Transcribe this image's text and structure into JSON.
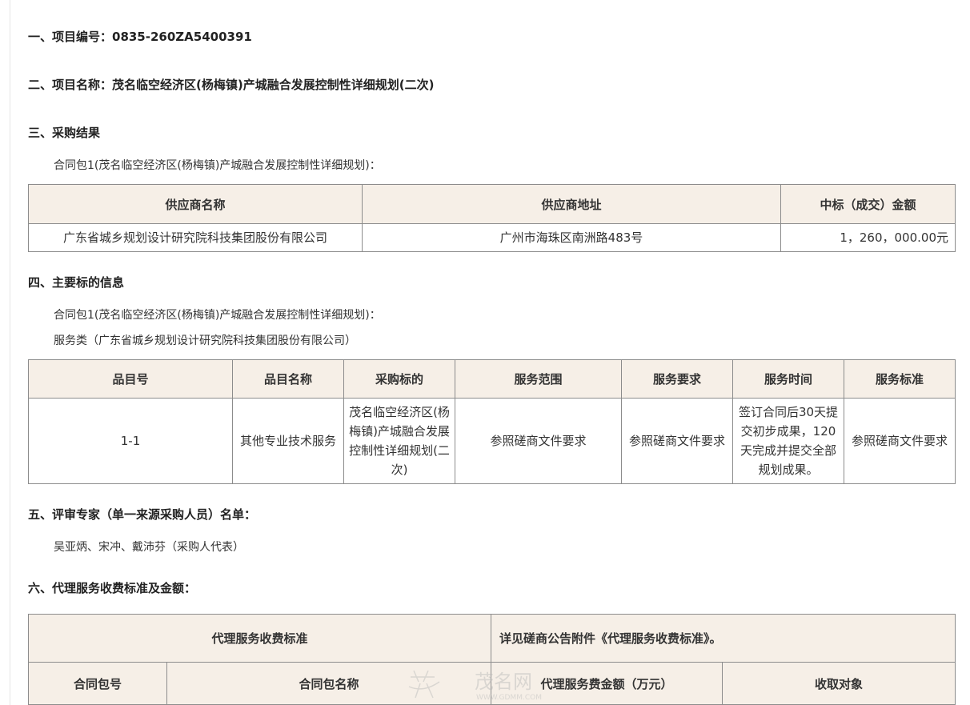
{
  "sections": {
    "s1": "一、项目编号：0835-260ZA5400391",
    "s2": "二、项目名称：茂名临空经济区(杨梅镇)产城融合发展控制性详细规划(二次)",
    "s3": "三、采购结果",
    "s4": "四、主要标的信息",
    "s5": "五、评审专家（单一来源采购人员）名单：",
    "s6": "六、代理服务收费标准及金额："
  },
  "result": {
    "package_label": "合同包1(茂名临空经济区(杨梅镇)产城融合发展控制性详细规划)：",
    "headers": [
      "供应商名称",
      "供应商地址",
      "中标（成交）金额"
    ],
    "row": [
      "广东省城乡规划设计研究院科技集团股份有限公司",
      "广州市海珠区南洲路483号",
      "1，260，000.00元"
    ]
  },
  "subject": {
    "package_label": "合同包1(茂名临空经济区(杨梅镇)产城融合发展控制性详细规划)：",
    "category_label": "服务类（广东省城乡规划设计研究院科技集团股份有限公司）",
    "headers": [
      "品目号",
      "品目名称",
      "采购标的",
      "服务范围",
      "服务要求",
      "服务时间",
      "服务标准"
    ],
    "row": [
      "1-1",
      "其他专业技术服务",
      "茂名临空经济区(杨梅镇)产城融合发展控制性详细规划(二次)",
      "参照磋商文件要求",
      "参照磋商文件要求",
      "签订合同后30天提交初步成果，120天完成并提交全部规划成果。",
      "参照磋商文件要求"
    ]
  },
  "experts": "吴亚炳、宋冲、戴沛芬（采购人代表）",
  "agency": {
    "standard_label": "代理服务收费标准",
    "standard_value": "详见磋商公告附件《代理服务收费标准》。",
    "headers": [
      "合同包号",
      "合同包名称",
      "代理服务费金额（万元）",
      "收取对象"
    ]
  },
  "watermark": {
    "text": "茂名网",
    "url": "WWW.GDMM.COM"
  }
}
